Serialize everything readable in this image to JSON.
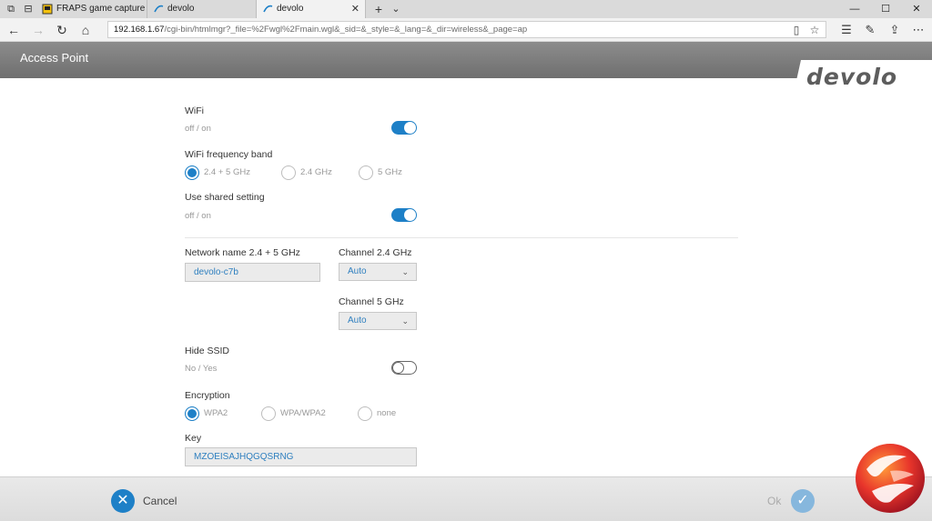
{
  "browser": {
    "tabs": [
      {
        "label": "FRAPS game capture video"
      },
      {
        "label": "devolo"
      },
      {
        "label": "devolo"
      }
    ],
    "address_domain": "192.168.1.67",
    "address_path": "/cgi-bin/htmlmgr?_file=%2Fwgl%2Fmain.wgl&_sid=&_style=&_lang=&_dir=wireless&_page=ap"
  },
  "header": {
    "title": "Access Point",
    "logo": "devolo"
  },
  "form": {
    "wifi": {
      "label": "WiFi",
      "sub": "off / on"
    },
    "band": {
      "label": "WiFi frequency band",
      "options": [
        "2.4 + 5 GHz",
        "2.4 GHz",
        "5 GHz"
      ],
      "selected": "2.4 + 5 GHz"
    },
    "shared": {
      "label": "Use shared setting",
      "sub": "off / on"
    },
    "network_name": {
      "label": "Network name 2.4 + 5 GHz",
      "value": "devolo-c7b"
    },
    "channel24": {
      "label": "Channel 2.4 GHz",
      "value": "Auto"
    },
    "channel5": {
      "label": "Channel 5 GHz",
      "value": "Auto"
    },
    "hide_ssid": {
      "label": "Hide SSID",
      "sub": "No / Yes"
    },
    "encryption": {
      "label": "Encryption",
      "options": [
        "WPA2",
        "WPA/WPA2",
        "none"
      ],
      "selected": "WPA2"
    },
    "key": {
      "label": "Key",
      "value": "MZOEISAJHQGQSRNG"
    }
  },
  "footer": {
    "cancel": "Cancel",
    "ok": "Ok"
  },
  "colors": {
    "accent": "#1e80c7",
    "header_gray": "#7d7d7d"
  }
}
